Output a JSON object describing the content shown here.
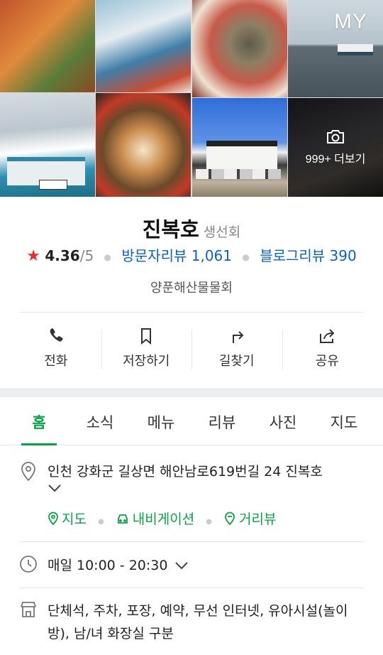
{
  "header": {
    "my_label": "MY",
    "more_photos_label": "999+ 더보기"
  },
  "place": {
    "name": "진복호",
    "category": "생선회",
    "rating": "4.36",
    "rating_max": "/5",
    "visitor_reviews": "방문자리뷰 1,061",
    "blog_reviews": "블로그리뷰 390",
    "subtitle": "양푼해산물물회"
  },
  "actions": [
    {
      "label": "전화",
      "icon": "phone-icon"
    },
    {
      "label": "저장하기",
      "icon": "bookmark-icon"
    },
    {
      "label": "길찾기",
      "icon": "directions-icon"
    },
    {
      "label": "공유",
      "icon": "share-icon"
    }
  ],
  "tabs": [
    "홈",
    "소식",
    "메뉴",
    "리뷰",
    "사진",
    "지도"
  ],
  "active_tab": "홈",
  "info": {
    "address": "인천 강화군 길상면 해안남로619번길 24 진복호",
    "links": [
      "지도",
      "내비게이션",
      "거리뷰"
    ],
    "hours": "매일 10:00 - 20:30",
    "amenities": "단체석, 주차, 포장, 예약, 무선 인터넷, 유아시설(놀이방), 남/녀 화장실 구분"
  },
  "colors": {
    "accent_green": "#05a544",
    "link_blue": "#0a63c8",
    "star_red": "#e62e2e"
  }
}
